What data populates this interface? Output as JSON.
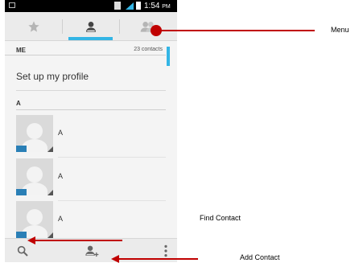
{
  "status_bar": {
    "time": "1:54",
    "ampm": "PM"
  },
  "tabs": [
    {
      "icon": "star-icon",
      "active": false
    },
    {
      "icon": "person-icon",
      "active": true
    },
    {
      "icon": "group-icon",
      "active": false
    }
  ],
  "section": {
    "label": "ME",
    "count": "23 contacts"
  },
  "profile": {
    "label": "Set up my profile"
  },
  "alpha_header": "A",
  "contacts": [
    {
      "name": "A"
    },
    {
      "name": "A"
    },
    {
      "name": "A"
    }
  ],
  "bottom_bar": {
    "icons": [
      "search-icon",
      "add-contact-icon",
      "overflow-menu-icon"
    ]
  },
  "annotations": {
    "menu": "Menu",
    "find_contact": "Find Contact",
    "add_contact": "Add Contact"
  },
  "colors": {
    "accent": "#33b5e5",
    "annotation": "#c00000"
  }
}
